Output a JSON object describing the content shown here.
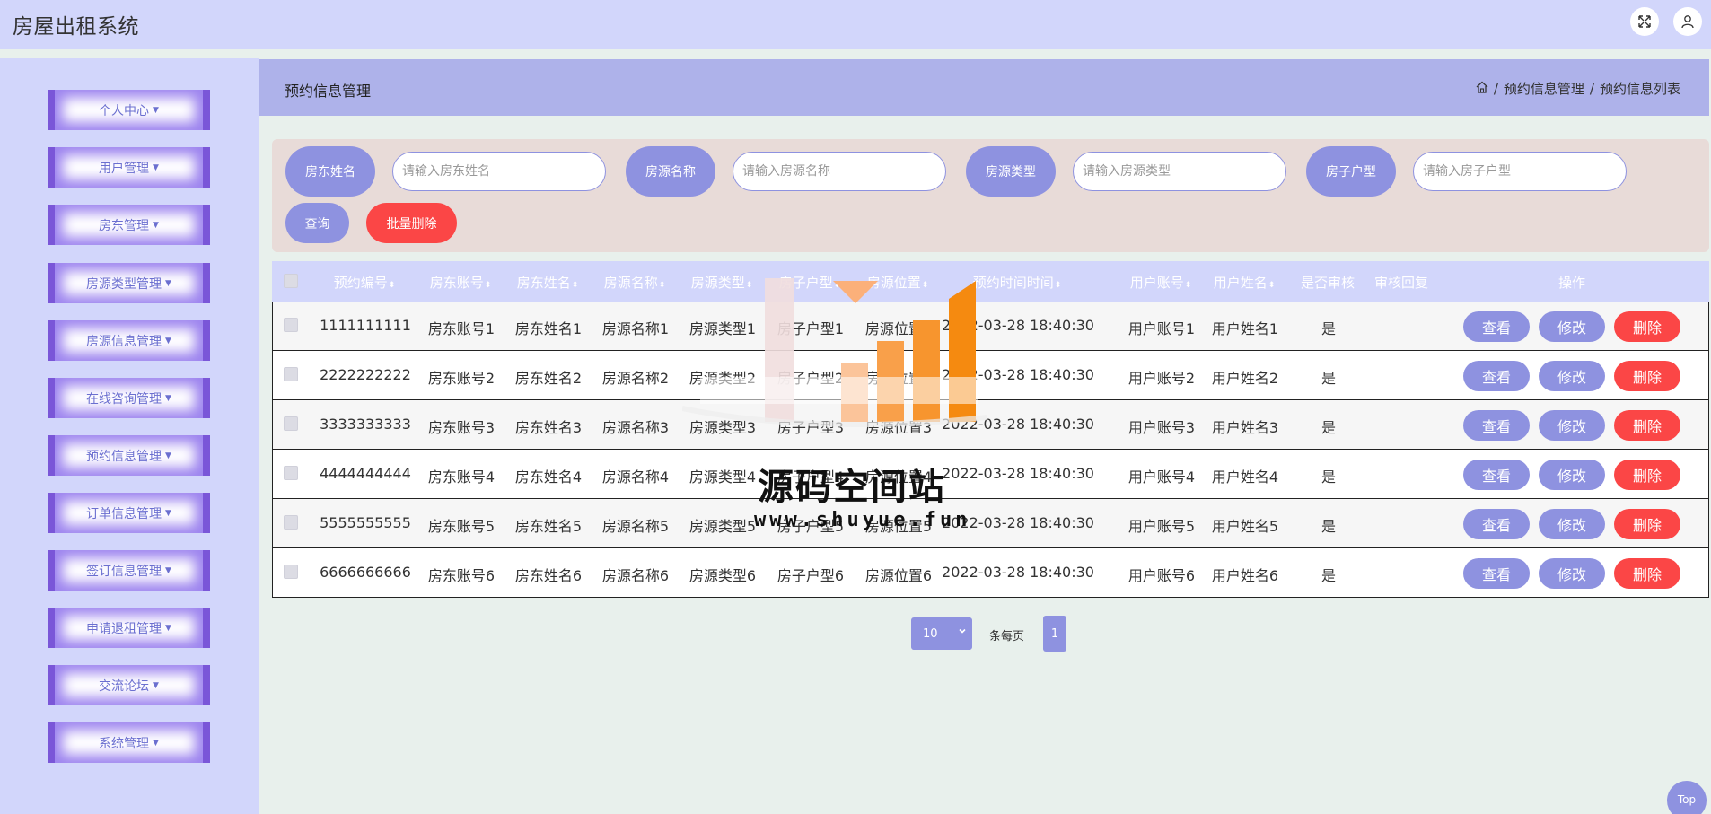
{
  "app": {
    "title": "房屋出租系统",
    "icons": {
      "fullscreen": "fullscreen-icon",
      "user": "user-icon"
    }
  },
  "sidebar": {
    "items": [
      {
        "label": "个人中心"
      },
      {
        "label": "用户管理"
      },
      {
        "label": "房东管理"
      },
      {
        "label": "房源类型管理"
      },
      {
        "label": "房源信息管理"
      },
      {
        "label": "在线咨询管理"
      },
      {
        "label": "预约信息管理"
      },
      {
        "label": "订单信息管理"
      },
      {
        "label": "签订信息管理"
      },
      {
        "label": "申请退租管理"
      },
      {
        "label": "交流论坛"
      },
      {
        "label": "系统管理"
      }
    ]
  },
  "page": {
    "title": "预约信息管理",
    "breadcrumb": [
      "预约信息管理",
      "预约信息列表"
    ],
    "breadcrumb_sep": "/"
  },
  "search": {
    "fields": [
      {
        "label": "房东姓名",
        "placeholder": "请输入房东姓名"
      },
      {
        "label": "房源名称",
        "placeholder": "请输入房源名称"
      },
      {
        "label": "房源类型",
        "placeholder": "请输入房源类型"
      },
      {
        "label": "房子户型",
        "placeholder": "请输入房子户型"
      }
    ],
    "query_label": "查询",
    "batch_delete_label": "批量删除"
  },
  "table": {
    "columns": [
      "预约编号",
      "房东账号",
      "房东姓名",
      "房源名称",
      "房源类型",
      "房子户型",
      "房源位置",
      "预约时间时间",
      "用户账号",
      "用户姓名",
      "是否审核",
      "审核回复",
      "操作"
    ],
    "sort_glyph": "⬍",
    "rows": [
      [
        "1111111111",
        "房东账号1",
        "房东姓名1",
        "房源名称1",
        "房源类型1",
        "房子户型1",
        "房源位置1",
        "2022-03-28 18:40:30",
        "用户账号1",
        "用户姓名1",
        "是",
        ""
      ],
      [
        "2222222222",
        "房东账号2",
        "房东姓名2",
        "房源名称2",
        "房源类型2",
        "房子户型2",
        "房源位置2",
        "2022-03-28 18:40:30",
        "用户账号2",
        "用户姓名2",
        "是",
        ""
      ],
      [
        "3333333333",
        "房东账号3",
        "房东姓名3",
        "房源名称3",
        "房源类型3",
        "房子户型3",
        "房源位置3",
        "2022-03-28 18:40:30",
        "用户账号3",
        "用户姓名3",
        "是",
        ""
      ],
      [
        "4444444444",
        "房东账号4",
        "房东姓名4",
        "房源名称4",
        "房源类型4",
        "房子户型4",
        "房源位置4",
        "2022-03-28 18:40:30",
        "用户账号4",
        "用户姓名4",
        "是",
        ""
      ],
      [
        "5555555555",
        "房东账号5",
        "房东姓名5",
        "房源名称5",
        "房源类型5",
        "房子户型5",
        "房源位置5",
        "2022-03-28 18:40:30",
        "用户账号5",
        "用户姓名5",
        "是",
        ""
      ],
      [
        "6666666666",
        "房东账号6",
        "房东姓名6",
        "房源名称6",
        "房源类型6",
        "房子户型6",
        "房源位置6",
        "2022-03-28 18:40:30",
        "用户账号6",
        "用户姓名6",
        "是",
        ""
      ]
    ],
    "actions": {
      "view": "查看",
      "edit": "修改",
      "delete": "删除"
    }
  },
  "pagination": {
    "page_size": "10",
    "page_size_label": "条每页",
    "current_page": "1"
  },
  "watermark": {
    "title": "源码空间站",
    "url": "www.shuyue.fun"
  },
  "back_to_top": "Top",
  "colors": {
    "primary": "#8e92e0",
    "danger": "#fb4646",
    "header_bg": "#d2d6fb",
    "accent_border": "#7a56d8"
  }
}
